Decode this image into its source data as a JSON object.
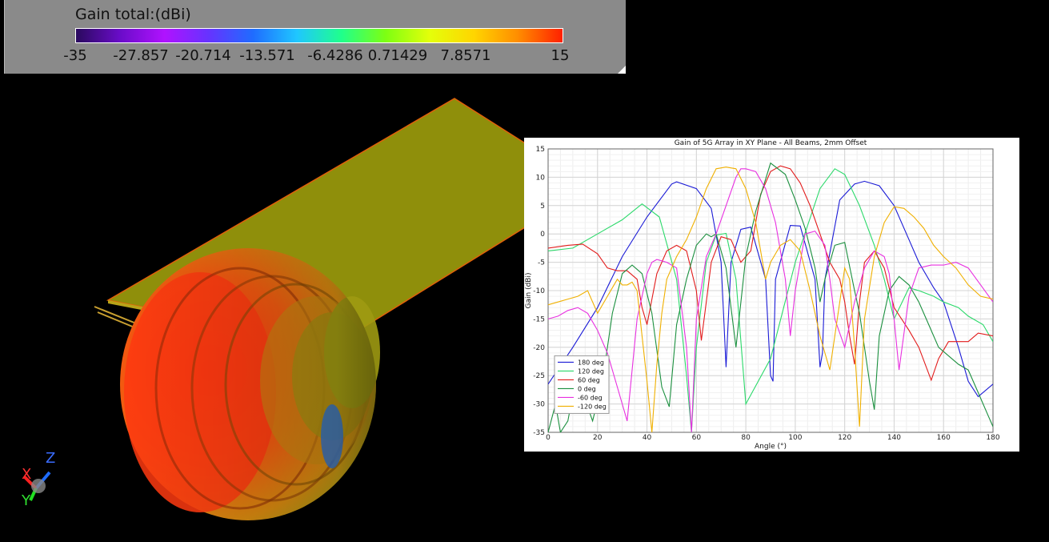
{
  "legend": {
    "title": "Gain total:(dBi)",
    "ticks": [
      "-35",
      "-27.857",
      "-20.714",
      "-13.571",
      "-6.4286",
      "0.71429",
      "7.8571",
      "15"
    ],
    "colors": [
      "#2a0a5e",
      "#6a0cc9",
      "#b012ff",
      "#6633ff",
      "#1f6cff",
      "#1fc7ff",
      "#1fff8c",
      "#7dff12",
      "#e4ff0a",
      "#ffd500",
      "#ff8c00",
      "#ff2000"
    ]
  },
  "axes_triad": {
    "x_label": "X",
    "y_label": "Y",
    "z_label": "Z"
  },
  "chart_data": {
    "type": "line",
    "title": "Gain of 5G Array in XY Plane - All Beams, 2mm Offset",
    "xlabel": "Angle (°)",
    "ylabel": "Gain (dBi)",
    "xlim": [
      0,
      180
    ],
    "ylim": [
      -35,
      15
    ],
    "xticks": [
      "0",
      "20",
      "40",
      "60",
      "80",
      "100",
      "120",
      "140",
      "160",
      "180"
    ],
    "yticks": [
      "15",
      "10",
      "5",
      "0",
      "-5",
      "-10",
      "-15",
      "-20",
      "-25",
      "-30",
      "-35"
    ],
    "grid": true,
    "legend_position": "bottom-left",
    "series": [
      {
        "name": "180 deg",
        "color": "#1a1ad6",
        "x": [
          0,
          10,
          20,
          30,
          40,
          50,
          52,
          60,
          66,
          70,
          72,
          74,
          78,
          82,
          88,
          90,
          91,
          92,
          98,
          102,
          108,
          110,
          111,
          112,
          118,
          124,
          128,
          134,
          140,
          146,
          150,
          156,
          160,
          166,
          170,
          174,
          180
        ],
        "y": [
          -26.5,
          -20,
          -13,
          -4,
          3,
          8.8,
          9.2,
          8,
          4.5,
          -5,
          -23.5,
          -5,
          0.8,
          1.2,
          -8,
          -25,
          -26,
          -8,
          1.5,
          1.4,
          -8,
          -23.5,
          -21,
          -8,
          6,
          8.8,
          9.3,
          8.5,
          5,
          -1,
          -5,
          -9.5,
          -12,
          -20,
          -26,
          -28.7,
          -26.5
        ]
      },
      {
        "name": "120 deg",
        "color": "#2bd96a",
        "x": [
          0,
          10,
          20,
          30,
          38,
          45,
          52,
          56,
          58,
          60,
          64,
          68,
          72,
          76,
          80,
          90,
          100,
          110,
          116,
          120,
          126,
          132,
          136,
          140,
          146,
          150,
          156,
          160,
          166,
          170,
          176,
          180
        ],
        "y": [
          -3,
          -2.5,
          0,
          2.5,
          5.3,
          3,
          -8,
          -25,
          -35,
          -20,
          -5,
          -0.2,
          0.1,
          -8,
          -30,
          -22,
          -5,
          8,
          11.5,
          10.5,
          5,
          -2,
          -8,
          -15,
          -9.5,
          -10,
          -11,
          -12,
          -13,
          -14.5,
          -16,
          -19
        ]
      },
      {
        "name": "60 deg",
        "color": "#e21b1b",
        "x": [
          0,
          8,
          14,
          20,
          24,
          28,
          32,
          36,
          38,
          40,
          44,
          48,
          52,
          56,
          60,
          62,
          64,
          66,
          70,
          74,
          78,
          82,
          86,
          90,
          94,
          98,
          102,
          106,
          110,
          114,
          118,
          120,
          122,
          124,
          126,
          128,
          132,
          136,
          140,
          146,
          150,
          155,
          158,
          162,
          166,
          170,
          174,
          180
        ],
        "y": [
          -2.5,
          -2,
          -1.8,
          -3.5,
          -6,
          -6.5,
          -6.5,
          -8,
          -13,
          -16,
          -7,
          -3,
          -2,
          -3,
          -10,
          -18.8,
          -12,
          -5,
          -0.5,
          -1,
          -5,
          -3,
          7,
          11,
          12,
          11.5,
          9,
          5,
          0,
          -5,
          -8,
          -12,
          -18,
          -23,
          -12,
          -5,
          -3,
          -6,
          -13,
          -17,
          -20,
          -25.8,
          -22,
          -19,
          -19,
          -19,
          -17.5,
          -18
        ]
      },
      {
        "name": "0 deg",
        "color": "#1a8f3e",
        "x": [
          0,
          3,
          5,
          8,
          11,
          14,
          18,
          22,
          26,
          30,
          34,
          38,
          42,
          46,
          49,
          52,
          56,
          60,
          64,
          66,
          68,
          72,
          76,
          80,
          84,
          90,
          96,
          100,
          104,
          108,
          110,
          112,
          116,
          120,
          124,
          126,
          130,
          132,
          134,
          138,
          142,
          146,
          150,
          154,
          158,
          162,
          166,
          170,
          174,
          178,
          180
        ],
        "y": [
          -35,
          -30,
          -35,
          -33,
          -26,
          -28,
          -33,
          -26,
          -14,
          -7,
          -5.5,
          -7,
          -14,
          -27,
          -30.5,
          -16,
          -8,
          -2,
          0,
          -0.5,
          0,
          -6,
          -20,
          -4,
          4,
          12.5,
          10.5,
          6,
          1,
          -6,
          -12,
          -8,
          -2,
          -1.5,
          -10,
          -14,
          -26,
          -31,
          -18,
          -10,
          -7.5,
          -9,
          -12,
          -16,
          -20,
          -21.5,
          -23,
          -24,
          -28,
          -32,
          -34
        ]
      },
      {
        "name": "-60 deg",
        "color": "#e830e0",
        "x": [
          0,
          4,
          8,
          12,
          16,
          20,
          24,
          28,
          32,
          36,
          40,
          42,
          44,
          48,
          52,
          56,
          58,
          60,
          64,
          68,
          72,
          76,
          78,
          80,
          84,
          88,
          92,
          96,
          98,
          100,
          104,
          108,
          112,
          114,
          116,
          120,
          124,
          128,
          132,
          136,
          138,
          140,
          142,
          146,
          150,
          155,
          160,
          165,
          170,
          175,
          180
        ],
        "y": [
          -15,
          -14.5,
          -13.5,
          -13,
          -14,
          -17,
          -21,
          -27,
          -33,
          -15,
          -7,
          -5,
          -4.5,
          -5,
          -6,
          -20,
          -35,
          -15,
          -4,
          0,
          5,
          10,
          11.5,
          11.5,
          11,
          8,
          2,
          -8,
          -18,
          -10,
          0,
          0.5,
          -2,
          -8,
          -15,
          -20,
          -12,
          -6,
          -3,
          -4,
          -7,
          -15,
          -24,
          -11,
          -6,
          -5.5,
          -5.5,
          -5,
          -6,
          -9,
          -12
        ]
      },
      {
        "name": "-120 deg",
        "color": "#f0b000",
        "x": [
          0,
          4,
          8,
          12,
          16,
          20,
          24,
          28,
          30,
          32,
          34,
          36,
          38,
          40,
          42,
          44,
          46,
          48,
          52,
          56,
          60,
          64,
          68,
          72,
          76,
          80,
          84,
          86,
          88,
          90,
          94,
          98,
          102,
          106,
          110,
          114,
          118,
          120,
          122,
          124,
          126,
          128,
          132,
          136,
          140,
          144,
          148,
          152,
          156,
          160,
          165,
          170,
          175,
          180
        ],
        "y": [
          -12.5,
          -12,
          -11.5,
          -11,
          -10,
          -14,
          -11,
          -8,
          -9,
          -9,
          -8.5,
          -10,
          -18,
          -26,
          -35,
          -23,
          -14,
          -8,
          -4,
          -1,
          3,
          8,
          11.5,
          11.8,
          11.5,
          8,
          2,
          -3,
          -8,
          -5,
          -2,
          -1,
          -3,
          -10,
          -18,
          -24,
          -12,
          -6,
          -8,
          -20,
          -34,
          -15,
          -4,
          2,
          4.8,
          4.5,
          3,
          1,
          -2,
          -4,
          -6,
          -9,
          -11,
          -11.5
        ]
      }
    ]
  }
}
